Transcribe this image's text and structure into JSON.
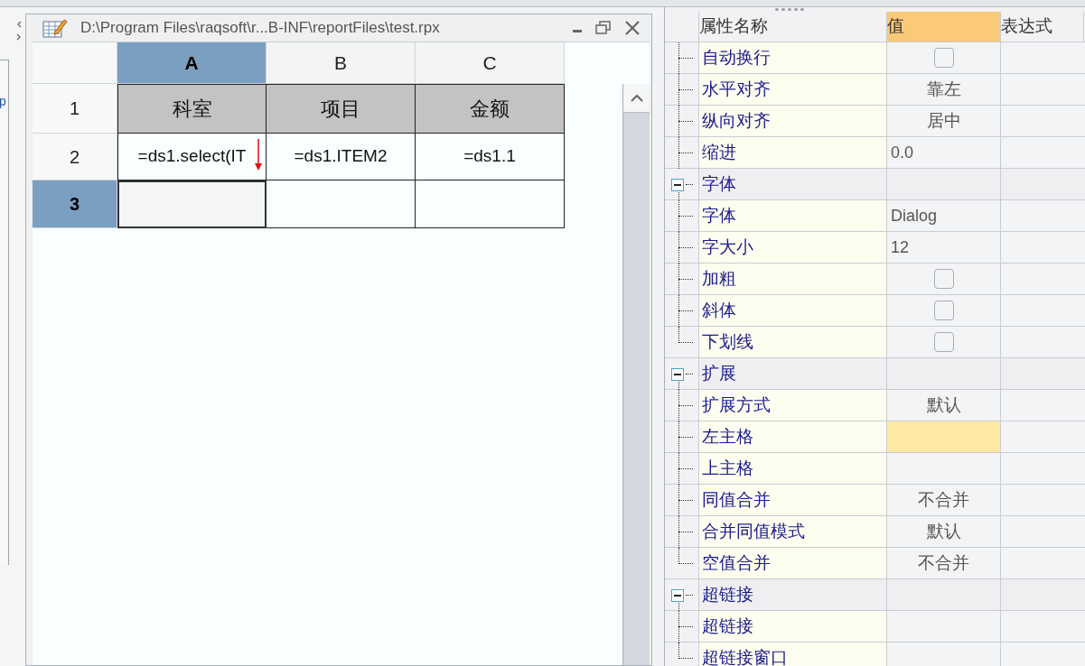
{
  "left_edge": {
    "text": "p"
  },
  "editor": {
    "title": "D:\\Program Files\\raqsoft\\r...B-INF\\reportFiles\\test.rpx",
    "columns": [
      {
        "label": "A",
        "selected": true
      },
      {
        "label": "B",
        "selected": false
      },
      {
        "label": "C",
        "selected": false
      }
    ],
    "rows": [
      {
        "label": "1",
        "selected": false,
        "cells": [
          {
            "text": "科室",
            "kind": "header",
            "selected": false,
            "expand_down": false
          },
          {
            "text": "项目",
            "kind": "header",
            "selected": false,
            "expand_down": false
          },
          {
            "text": "金额",
            "kind": "header",
            "selected": false,
            "expand_down": false
          }
        ]
      },
      {
        "label": "2",
        "selected": false,
        "cells": [
          {
            "text": "=ds1.select(IT",
            "kind": "formula",
            "selected": false,
            "expand_down": true
          },
          {
            "text": "=ds1.ITEM2",
            "kind": "formula",
            "selected": false,
            "expand_down": false
          },
          {
            "text": "=ds1.1",
            "kind": "formula",
            "selected": false,
            "expand_down": false
          }
        ]
      },
      {
        "label": "3",
        "selected": true,
        "cells": [
          {
            "kind": "formula",
            "selected": true,
            "expand_down": false
          },
          {
            "kind": "formula",
            "selected": false,
            "expand_down": false
          },
          {
            "kind": "formula",
            "selected": false,
            "expand_down": false
          }
        ]
      }
    ]
  },
  "properties": {
    "columns": [
      {
        "label": "属性名称",
        "selected": false
      },
      {
        "label": "值",
        "selected": true
      },
      {
        "label": "表达式",
        "selected": false
      }
    ],
    "items": [
      {
        "kind": "checkbox",
        "label": "自动换行",
        "checked": false,
        "selected": false
      },
      {
        "kind": "choice",
        "label": "水平对齐",
        "value": "靠左",
        "selected": false
      },
      {
        "kind": "choice",
        "label": "纵向对齐",
        "value": "居中",
        "selected": false
      },
      {
        "kind": "text",
        "label": "缩进",
        "value": "0.0",
        "selected": false
      },
      {
        "kind": "group",
        "label": "字体",
        "expanded": true,
        "children": [
          {
            "kind": "text",
            "label": "字体",
            "value": "Dialog",
            "selected": false
          },
          {
            "kind": "text",
            "label": "字大小",
            "value": "12",
            "selected": false
          },
          {
            "kind": "checkbox",
            "label": "加粗",
            "checked": false,
            "selected": false
          },
          {
            "kind": "checkbox",
            "label": "斜体",
            "checked": false,
            "selected": false
          },
          {
            "kind": "checkbox",
            "label": "下划线",
            "checked": false,
            "selected": false
          }
        ]
      },
      {
        "kind": "group",
        "label": "扩展",
        "expanded": true,
        "children": [
          {
            "kind": "choice",
            "label": "扩展方式",
            "value": "默认",
            "selected": false
          },
          {
            "kind": "text",
            "label": "左主格",
            "selected": true
          },
          {
            "kind": "text",
            "label": "上主格",
            "selected": false
          },
          {
            "kind": "choice",
            "label": "同值合并",
            "value": "不合并",
            "selected": false
          },
          {
            "kind": "choice",
            "label": "合并同值模式",
            "value": "默认",
            "selected": false
          },
          {
            "kind": "choice",
            "label": "空值合并",
            "value": "不合并",
            "selected": false
          }
        ]
      },
      {
        "kind": "group",
        "label": "超链接",
        "expanded": true,
        "children": [
          {
            "kind": "text",
            "label": "超链接",
            "selected": false
          },
          {
            "kind": "text",
            "label": "超链接窗口",
            "selected": false
          }
        ]
      }
    ]
  }
}
